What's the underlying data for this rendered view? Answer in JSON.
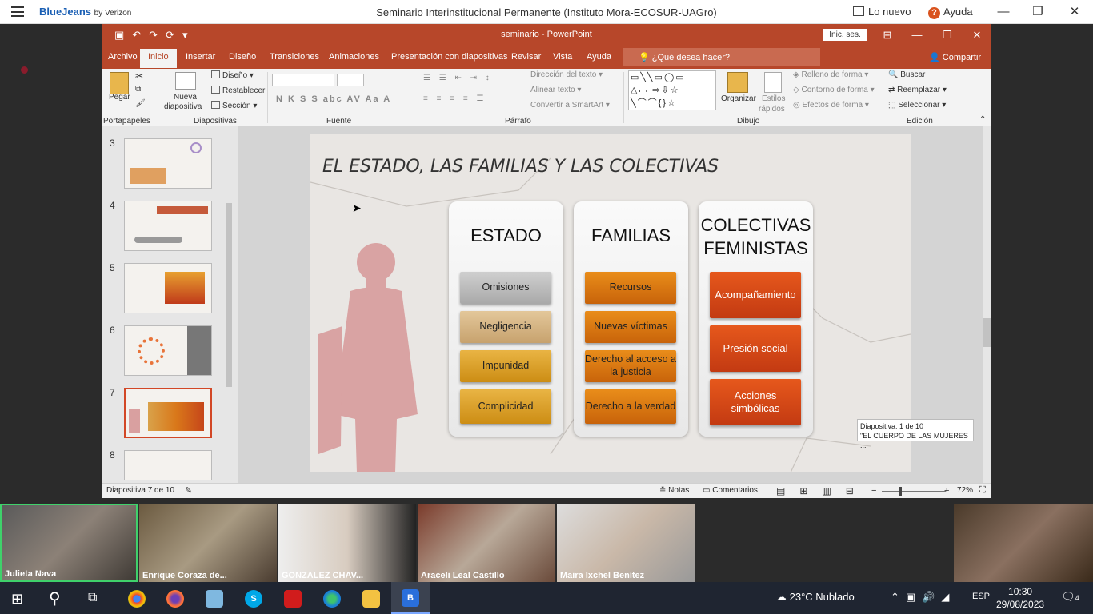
{
  "bluejeans": {
    "logo": "BlueJeans",
    "by": "by Verizon",
    "meeting_title": "Seminario Interinstitucional Permanente (Instituto Mora-ECOSUR-UAGro)",
    "lo_nuevo": "Lo nuevo",
    "ayuda": "Ayuda"
  },
  "ppt": {
    "title": "seminario - PowerPoint",
    "sign_in": "Inic. ses.",
    "tabs": [
      "Archivo",
      "Inicio",
      "Insertar",
      "Diseño",
      "Transiciones",
      "Animaciones",
      "Presentación con diapositivas",
      "Revisar",
      "Vista",
      "Ayuda"
    ],
    "tell_me": "¿Qué desea hacer?",
    "share": "Compartir",
    "ribbon": {
      "pegar": "Pegar",
      "nueva": "Nueva",
      "diapositiva": "diapositiva",
      "diseno": "Diseño",
      "restablecer": "Restablecer",
      "seccion": "Sección",
      "dir_texto": "Dirección del texto",
      "alinear_texto": "Alinear texto",
      "convertir": "Convertir a SmartArt",
      "organizar": "Organizar",
      "estilos": "Estilos",
      "rapidos": "rápidos",
      "relleno": "Relleno de forma",
      "contorno": "Contorno de forma",
      "efectos": "Efectos de forma",
      "buscar": "Buscar",
      "reemplazar": "Reemplazar",
      "seleccionar": "Seleccionar",
      "font_buttons": "N  K  S  S  abc  AV  Aa  A",
      "groups": {
        "portapapeles": "Portapapeles",
        "diapositivas": "Diapositivas",
        "fuente": "Fuente",
        "parrafo": "Párrafo",
        "dibujo": "Dibujo",
        "edicion": "Edición"
      }
    },
    "thumb_numbers": [
      "3",
      "4",
      "5",
      "6",
      "7",
      "8"
    ],
    "slide": {
      "title": "EL ESTADO, LAS FAMILIAS Y LAS COLECTIVAS",
      "columns": [
        {
          "heading": "ESTADO",
          "items": [
            "Omisiones",
            "Negligencia",
            "Impunidad",
            "Complicidad"
          ]
        },
        {
          "heading": "FAMILIAS",
          "items": [
            "Recursos",
            "Nuevas víctimas",
            "Derecho al acceso a la justicia",
            "Derecho a la verdad"
          ]
        },
        {
          "heading": "COLECTIVAS FEMINISTAS",
          "items": [
            "Acompañamiento",
            "Presión social",
            "Acciones simbólicas"
          ]
        }
      ]
    },
    "tooltip": {
      "line1": "Diapositiva: 1 de 10",
      "line2": "\"EL CUERPO DE LAS MUJERES ..."
    },
    "status": {
      "slide": "Diapositiva 7 de 10",
      "notas": "Notas",
      "comentarios": "Comentarios",
      "zoom": "72%"
    }
  },
  "participants": [
    "Julieta Nava",
    "Enrique Coraza de...",
    "GONZALEZ CHAV...",
    "Araceli Leal Castillo",
    "Maira Ixchel Benítez"
  ],
  "taskbar": {
    "weather": "23°C  Nublado",
    "lang": "ESP",
    "time": "10:30",
    "date": "29/08/2023",
    "notif": "4"
  }
}
